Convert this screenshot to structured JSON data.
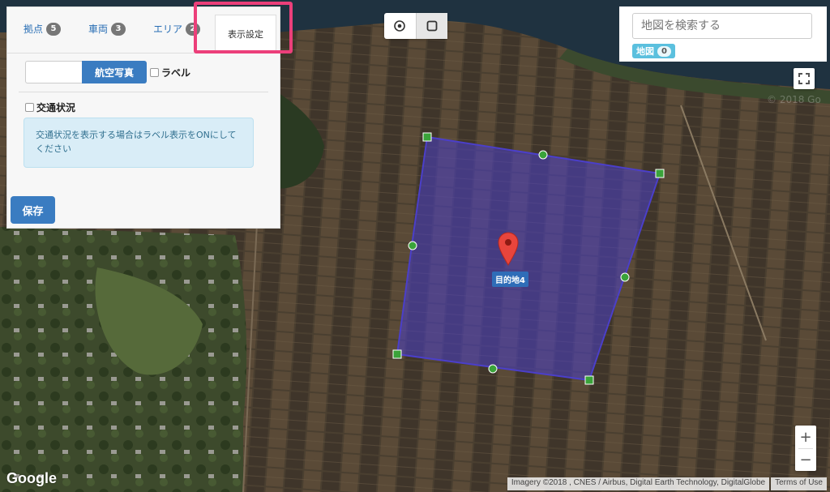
{
  "tabs": [
    {
      "label": "拠点",
      "count": "5"
    },
    {
      "label": "車両",
      "count": "3"
    },
    {
      "label": "エリア",
      "count": "2"
    },
    {
      "label": "表示設定"
    }
  ],
  "map_type": {
    "selected_label": "航空写真"
  },
  "label_checkbox": {
    "label": "ラベル",
    "checked": false
  },
  "traffic_checkbox": {
    "label": "交通状況",
    "checked": false
  },
  "info_message": "交通状況を表示する場合はラベル表示をONにしてください",
  "save_label": "保存",
  "search": {
    "placeholder": "地図を検索する"
  },
  "map_badge": {
    "label": "地図",
    "count": "0"
  },
  "zoom": {
    "in": "+",
    "out": "−"
  },
  "marker": {
    "label": "目的地4"
  },
  "watermark": "© 2018 Go",
  "google_logo": "Google",
  "attribution": "Imagery ©2018 , CNES / Airbus, Digital Earth Technology, DigitalGlobe",
  "terms": "Terms of Use",
  "colors": {
    "accent": "#3a7cc1",
    "highlight": "#ec3f7a",
    "polygon": "#4b3fc9",
    "info_bg": "#d9edf7"
  }
}
